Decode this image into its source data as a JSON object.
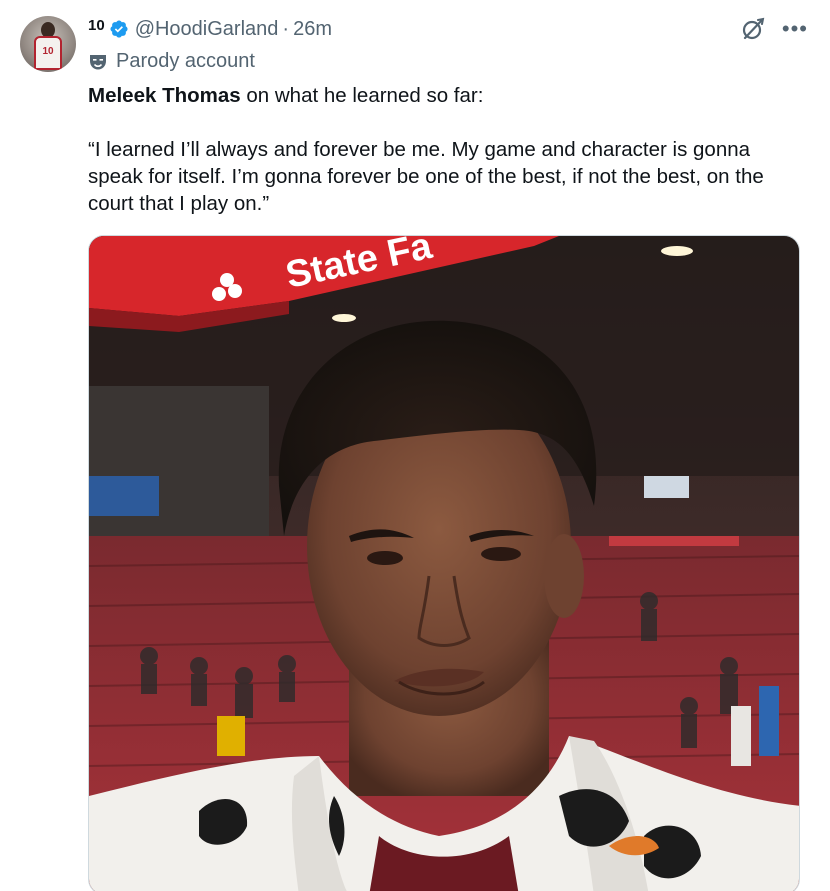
{
  "author": {
    "display_name": "10",
    "handle": "@HoodiGarland",
    "separator": "·",
    "time": "26m",
    "label": "Parody account",
    "avatar_number": "10"
  },
  "post": {
    "subject": "Meleek Thomas",
    "lead_rest": " on what he learned so far:",
    "quote": "“I learned I’ll always and forever be me. My game and character is gonna speak for itself. I’m gonna forever be one of the best, if not the best, on the court that I play on.”"
  },
  "media": {
    "signage_text": "State Fa"
  },
  "icons": {
    "verified": "verified-badge-icon",
    "parody": "mask-icon",
    "grok": "grok-icon",
    "more": "more-icon"
  },
  "colors": {
    "verified": "#1d9bf0",
    "secondary_text": "#536471",
    "primary_text": "#0f1419",
    "signage_red": "#d7262b"
  }
}
